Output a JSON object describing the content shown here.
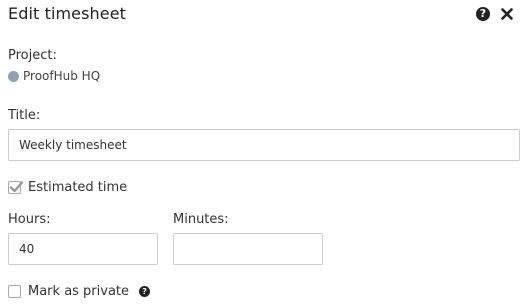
{
  "dialog": {
    "title": "Edit timesheet",
    "help_icon": "question-circle-icon",
    "close_icon": "close-x-icon"
  },
  "project": {
    "label": "Project:",
    "value": "ProofHub HQ",
    "dot_color": "#8ea2b0"
  },
  "title_field": {
    "label": "Title:",
    "value": "Weekly timesheet"
  },
  "estimated_time": {
    "label": "Estimated time",
    "checked": true
  },
  "hours": {
    "label": "Hours:",
    "value": "40"
  },
  "minutes": {
    "label": "Minutes:",
    "value": ""
  },
  "mark_private": {
    "label": "Mark as private",
    "checked": false
  }
}
